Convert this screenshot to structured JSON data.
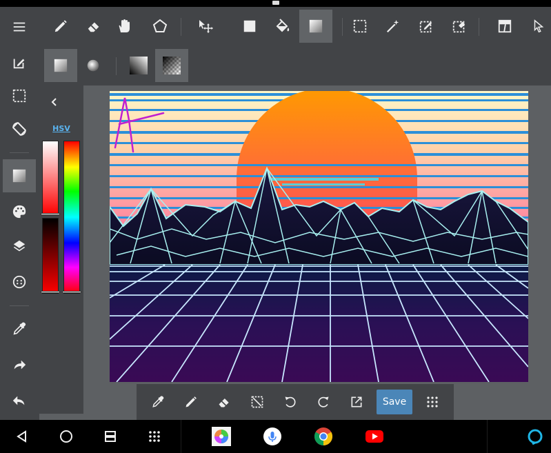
{
  "toolbar": {
    "tools": [
      {
        "icon": "brush-icon"
      },
      {
        "icon": "eraser-icon"
      },
      {
        "icon": "hand-icon"
      },
      {
        "icon": "polygon-icon"
      },
      {
        "icon": "move-icon"
      },
      {
        "icon": "fill-rectangle-icon"
      },
      {
        "icon": "bucket-icon"
      },
      {
        "icon": "gradient-icon",
        "active": true
      },
      {
        "icon": "select-rect-icon"
      },
      {
        "icon": "magic-wand-icon"
      },
      {
        "icon": "select-pen-icon"
      },
      {
        "icon": "select-eraser-icon"
      },
      {
        "icon": "layout-icon"
      },
      {
        "icon": "cursor-icon"
      }
    ]
  },
  "subtoolbar": {
    "options": [
      {
        "icon": "linear-gradient-icon",
        "active": true
      },
      {
        "icon": "radial-gradient-icon"
      },
      {
        "icon": "fg-to-bg-gradient-icon"
      },
      {
        "icon": "fg-to-transparent-gradient-icon",
        "active": true
      }
    ]
  },
  "sidebar": {
    "items": [
      {
        "icon": "menu-icon"
      },
      {
        "icon": "edit-icon"
      },
      {
        "icon": "selection-icon"
      },
      {
        "icon": "rotate-icon"
      },
      {
        "icon": "gradient-tool-icon",
        "active": true
      },
      {
        "icon": "palette-icon"
      },
      {
        "icon": "layers-icon"
      },
      {
        "icon": "more-icon"
      },
      {
        "icon": "eyedropper-icon"
      },
      {
        "icon": "redo-icon"
      },
      {
        "icon": "undo-icon"
      }
    ]
  },
  "colorpanel": {
    "mode_label": "HSV",
    "colors": {
      "current": "#ff0000"
    }
  },
  "bottombar": {
    "tools": [
      {
        "icon": "eyedropper-icon"
      },
      {
        "icon": "pen-icon"
      },
      {
        "icon": "eraser-icon"
      },
      {
        "icon": "clear-selection-icon"
      },
      {
        "icon": "undo-icon"
      },
      {
        "icon": "redo-icon"
      },
      {
        "icon": "export-icon"
      }
    ],
    "save_label": "Save",
    "grid_icon": "grid-icon"
  },
  "navbar": {
    "buttons": [
      {
        "icon": "back-icon"
      },
      {
        "icon": "home-icon"
      },
      {
        "icon": "recents-icon"
      },
      {
        "icon": "apps-grid-icon"
      }
    ],
    "apps": [
      {
        "icon": "medibang-app-icon"
      },
      {
        "icon": "voice-assistant-icon"
      },
      {
        "icon": "chrome-icon"
      },
      {
        "icon": "youtube-icon"
      }
    ],
    "right_icon": "alexa-icon"
  },
  "colors": {
    "accent": "#4b86b8",
    "panel": "#424447",
    "active": "#616467",
    "background": "#5d6063"
  }
}
